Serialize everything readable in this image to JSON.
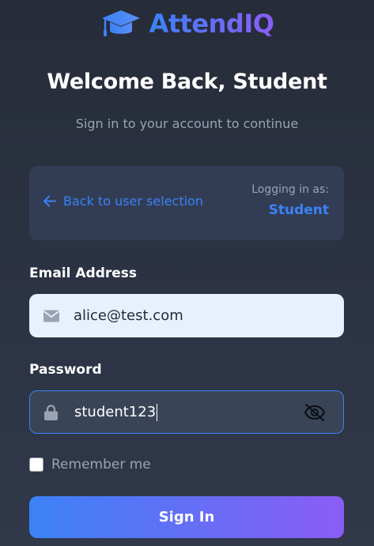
{
  "brand": {
    "name": "AttendIQ",
    "icon": "graduation-cap-icon"
  },
  "header": {
    "title": "Welcome Back, Student",
    "subtitle": "Sign in to your account to continue"
  },
  "role_card": {
    "back_label": "Back to user selection",
    "back_icon": "arrow-left-icon",
    "logging_label": "Logging in as:",
    "role": "Student"
  },
  "form": {
    "email_label": "Email Address",
    "email_value": "alice@test.com",
    "email_icon": "envelope-icon",
    "password_label": "Password",
    "password_value": "student123",
    "password_icon": "lock-icon",
    "password_toggle_icon": "eye-off-icon",
    "remember_label": "Remember me",
    "remember_checked": false,
    "submit_label": "Sign In"
  },
  "colors": {
    "accent_blue": "#3b82f6",
    "accent_purple": "#8b5cf6",
    "background": "#2c3344",
    "card_background": "#323d55",
    "email_field_background": "#e8f0fe"
  }
}
